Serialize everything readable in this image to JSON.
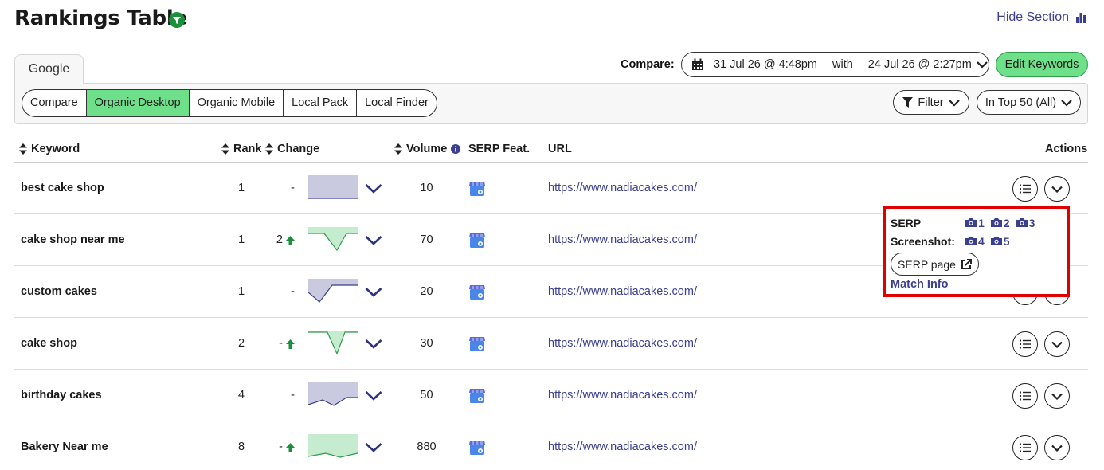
{
  "page": {
    "title": "Rankings Table",
    "hide_section": "Hide Section"
  },
  "tabs": {
    "engine": "Google",
    "modes": [
      "Compare",
      "Organic Desktop",
      "Organic Mobile",
      "Local Pack",
      "Local Finder"
    ],
    "active_mode": "Organic Desktop"
  },
  "compare": {
    "label": "Compare:",
    "date_from": "31 Jul 26 @ 4:48pm",
    "with": "with",
    "date_to": "24 Jul 26 @ 2:27pm"
  },
  "buttons": {
    "edit_keywords": "Edit Keywords",
    "filter": "Filter",
    "top_filter": "In Top 50 (All)"
  },
  "table": {
    "headers": {
      "keyword": "Keyword",
      "rank": "Rank",
      "change": "Change",
      "volume": "Volume",
      "serp_feat": "SERP Feat.",
      "url": "URL",
      "actions": "Actions"
    },
    "rows": [
      {
        "keyword": "best cake shop",
        "rank": "1",
        "change": "-",
        "up": false,
        "volume": "10",
        "url": "https://www.nadiacakes.com/",
        "trend": "flat"
      },
      {
        "keyword": "cake shop near me",
        "rank": "1",
        "change": "2",
        "up": true,
        "volume": "70",
        "url": "https://www.nadiacakes.com/",
        "trend": "dip-green"
      },
      {
        "keyword": "custom cakes",
        "rank": "1",
        "change": "-",
        "up": false,
        "volume": "20",
        "url": "https://www.nadiacakes.com/",
        "trend": "drop-purple"
      },
      {
        "keyword": "cake shop",
        "rank": "2",
        "change": "-",
        "up": true,
        "volume": "30",
        "url": "https://www.nadiacakes.com/",
        "trend": "vdip-green"
      },
      {
        "keyword": "birthday cakes",
        "rank": "4",
        "change": "-",
        "up": false,
        "volume": "50",
        "url": "https://www.nadiacakes.com/",
        "trend": "wave-purple"
      },
      {
        "keyword": "Bakery Near me",
        "rank": "8",
        "change": "-",
        "up": true,
        "volume": "880",
        "url": "https://www.nadiacakes.com/",
        "trend": "wave-green"
      }
    ]
  },
  "popup": {
    "serp_label": "SERP",
    "screenshot_label": "Screenshot:",
    "shots_row1": [
      "1",
      "2",
      "3"
    ],
    "shots_row2": [
      "4",
      "5"
    ],
    "serp_page": "SERP page",
    "match_info": "Match Info"
  },
  "colors": {
    "accent_green": "#6ee08a",
    "link_purple": "#3b3f8f",
    "highlight_red": "#e00000",
    "up_arrow": "#1a8f3c"
  }
}
